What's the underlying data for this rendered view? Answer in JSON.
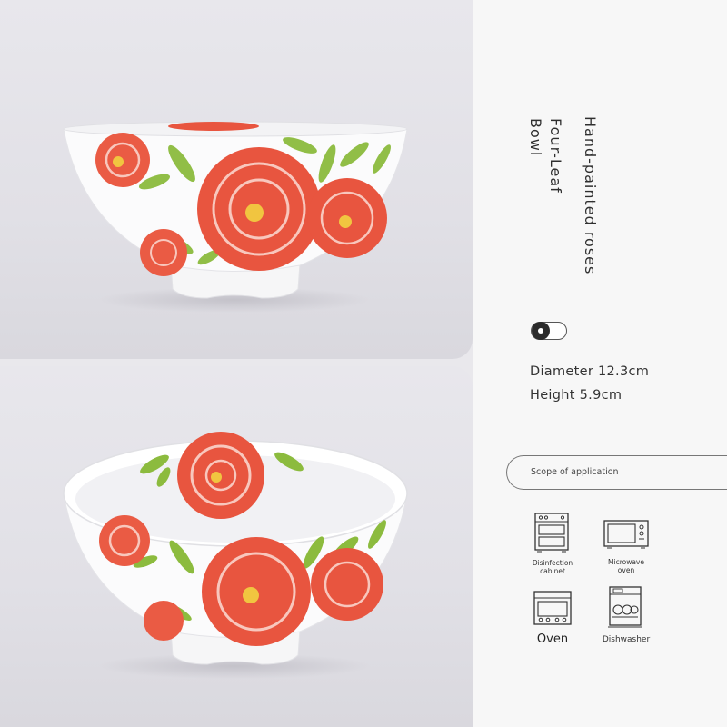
{
  "product": {
    "title_line1": "Hand-painted roses",
    "title_line2": "Four-Leaf",
    "title_line3": "Bowl"
  },
  "specs": {
    "diameter": "Diameter 12.3cm",
    "height": "Height 5.9cm"
  },
  "scope": {
    "label": "Scope of application",
    "items": [
      {
        "label": "Disinfection\ncabinet",
        "icon": "disinfection-cabinet-icon"
      },
      {
        "label": "Microwave\noven",
        "icon": "microwave-oven-icon"
      },
      {
        "label": "Oven",
        "icon": "oven-icon"
      },
      {
        "label": "Dishwasher",
        "icon": "dishwasher-icon"
      }
    ]
  },
  "colors": {
    "rose": "#e8553f",
    "leaf": "#8cbb3e",
    "porcelain": "#ffffff",
    "panel_bg": "#f7f7f7"
  }
}
